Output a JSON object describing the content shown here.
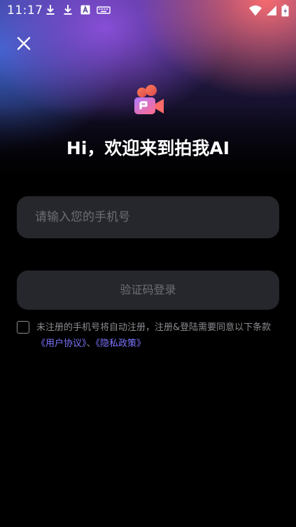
{
  "status_bar": {
    "time": "11:17",
    "icons": [
      "download-icon",
      "download-icon",
      "a-icon",
      "keyboard-icon",
      "wifi-icon",
      "signal-icon",
      "battery-icon"
    ]
  },
  "header": {
    "close_icon": "close-icon",
    "logo_icon": "video-camera-logo-icon",
    "title": "Hi，欢迎来到拍我AI"
  },
  "form": {
    "phone_placeholder": "请输入您的手机号",
    "phone_value": "",
    "login_button": "验证码登录",
    "agreement": {
      "checked": false,
      "text_before": "未注册的手机号将自动注册，注册&登陆需要同意以下条款",
      "user_agreement": "《用户协议》",
      "separator": "、",
      "privacy_policy": "《隐私政策》"
    }
  },
  "colors": {
    "background": "#000000",
    "field": "#26272c",
    "link": "#7b76ff",
    "muted": "#8b8c92"
  }
}
